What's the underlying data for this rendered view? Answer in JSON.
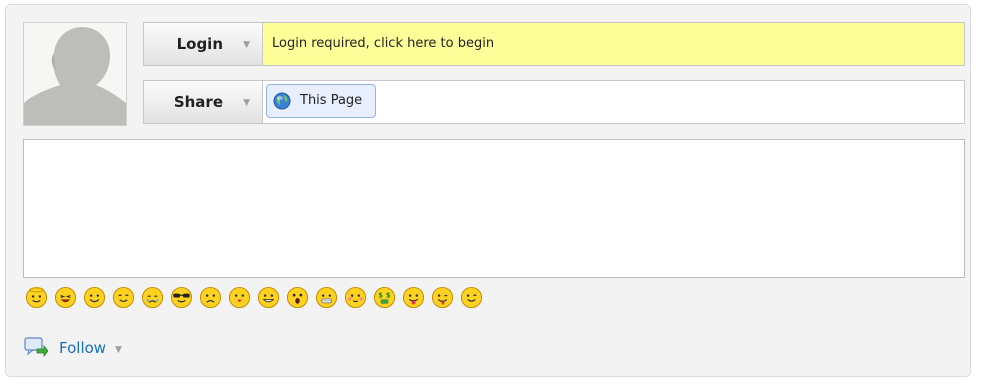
{
  "login": {
    "tab_label": "Login",
    "message": "Login required, click here to begin"
  },
  "share": {
    "tab_label": "Share",
    "button_label": "This Page"
  },
  "comment": {
    "value": ""
  },
  "emojis": [
    "angel-emoji-icon",
    "laughing-emoji-icon",
    "smile-emoji-icon",
    "content-emoji-icon",
    "crying-emoji-icon",
    "sunglasses-emoji-icon",
    "sad-emoji-icon",
    "kiss-emoji-icon",
    "grin-emoji-icon",
    "surprised-emoji-icon",
    "braces-emoji-icon",
    "blushing-emoji-icon",
    "money-mouth-emoji-icon",
    "tongue-emoji-icon",
    "silly-emoji-icon",
    "wink-emoji-icon"
  ],
  "follow": {
    "label": "Follow"
  },
  "colors": {
    "login_message_bg": "#ffff99",
    "link": "#1a6fc0",
    "emoji_face": "#ffd21f"
  }
}
